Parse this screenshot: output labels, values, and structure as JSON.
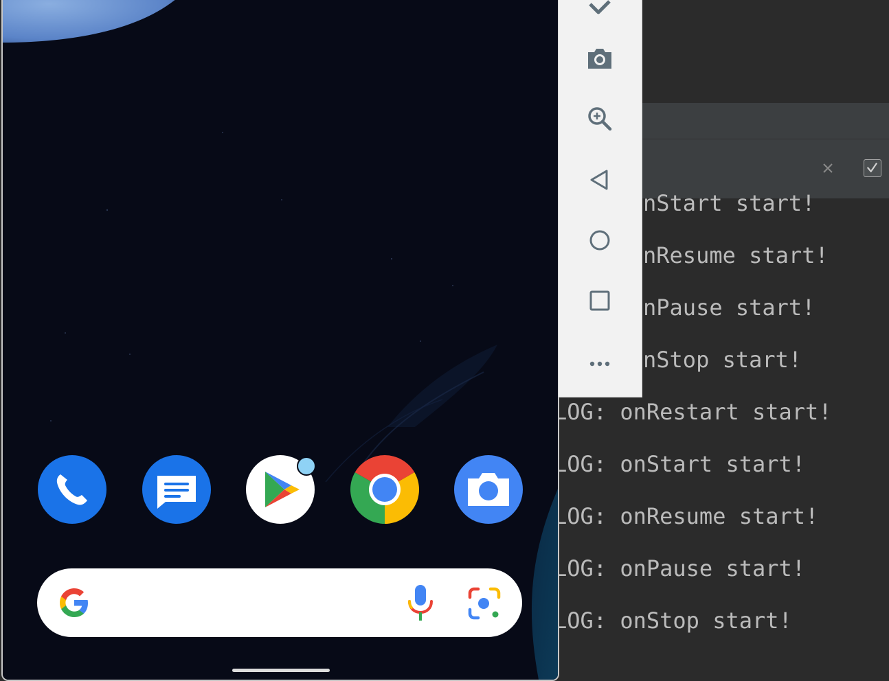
{
  "emulator_toolbar": {
    "buttons": [
      "rotate-icon",
      "screenshot-icon",
      "zoom-icon",
      "back-icon",
      "home-icon",
      "overview-icon",
      "more-icon"
    ]
  },
  "logcat": {
    "filter": {
      "value": "",
      "placeholder": ""
    },
    "match_case_checked": true,
    "lines": [
      {
        "visible_text": "nStart start!"
      },
      {
        "visible_text": "nResume start!"
      },
      {
        "visible_text": "nPause start!"
      },
      {
        "visible_text": "nStop start!"
      },
      {
        "visible_text": "LOG: onRestart start!"
      },
      {
        "visible_text": "LOG: onStart start!"
      },
      {
        "visible_text": "LOG: onResume start!"
      },
      {
        "visible_text": "LOG: onPause start!"
      },
      {
        "visible_text": "LOG: onStop start!"
      }
    ]
  },
  "home_screen": {
    "dock_apps": [
      "Phone",
      "Messages",
      "Play Store",
      "Chrome",
      "Camera"
    ],
    "play_store_has_notification_dot": true,
    "search": {
      "logo": "G",
      "mic_icon": "mic-icon",
      "lens_icon": "lens-icon"
    }
  },
  "colors": {
    "logcat_bg": "#2b2b2b",
    "log_text": "#bbbbbb",
    "toolbar_bg": "#f2f2f2",
    "toolbar_icon": "#5f6f7a",
    "phone_blue": "#1a73e8",
    "google_red": "#ea4335",
    "google_yellow": "#fbbc04",
    "google_green": "#34a853",
    "google_blue": "#4285f4"
  }
}
